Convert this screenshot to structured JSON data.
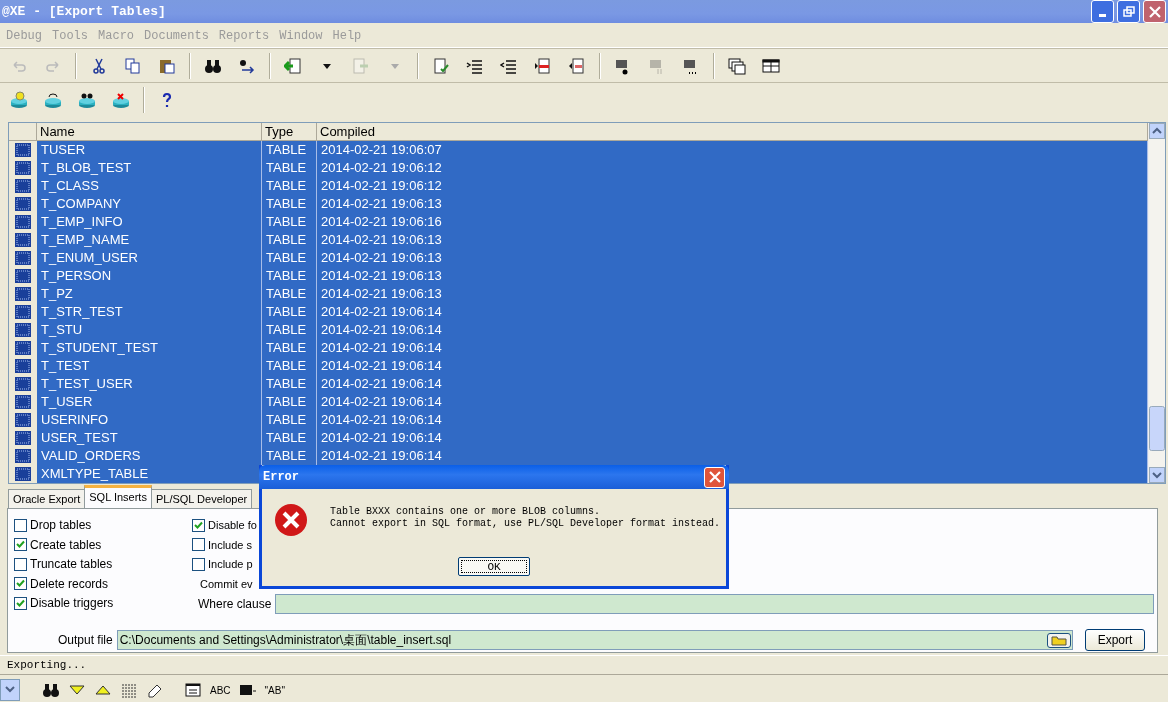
{
  "window": {
    "title": "@XE - [Export Tables]"
  },
  "menu": [
    {
      "label": "Debug",
      "disabled": true
    },
    {
      "label": "Tools",
      "disabled": true
    },
    {
      "label": "Macro",
      "disabled": true
    },
    {
      "label": "Documents",
      "disabled": true
    },
    {
      "label": "Reports",
      "disabled": true
    },
    {
      "label": "Window",
      "disabled": true
    },
    {
      "label": "Help",
      "disabled": true
    }
  ],
  "table": {
    "columns": [
      "Name",
      "Type",
      "Compiled"
    ],
    "rows": [
      {
        "cells": [
          "TUSER",
          "TABLE",
          "2014-02-21 19:06:07"
        ],
        "selected": true
      },
      {
        "cells": [
          "T_BLOB_TEST",
          "TABLE",
          "2014-02-21 19:06:12"
        ],
        "selected": true
      },
      {
        "cells": [
          "T_CLASS",
          "TABLE",
          "2014-02-21 19:06:12"
        ],
        "selected": true
      },
      {
        "cells": [
          "T_COMPANY",
          "TABLE",
          "2014-02-21 19:06:13"
        ],
        "selected": true
      },
      {
        "cells": [
          "T_EMP_INFO",
          "TABLE",
          "2014-02-21 19:06:16"
        ],
        "selected": true
      },
      {
        "cells": [
          "T_EMP_NAME",
          "TABLE",
          "2014-02-21 19:06:13"
        ],
        "selected": true
      },
      {
        "cells": [
          "T_ENUM_USER",
          "TABLE",
          "2014-02-21 19:06:13"
        ],
        "selected": true
      },
      {
        "cells": [
          "T_PERSON",
          "TABLE",
          "2014-02-21 19:06:13"
        ],
        "selected": true
      },
      {
        "cells": [
          "T_PZ",
          "TABLE",
          "2014-02-21 19:06:13"
        ],
        "selected": true
      },
      {
        "cells": [
          "T_STR_TEST",
          "TABLE",
          "2014-02-21 19:06:14"
        ],
        "selected": true
      },
      {
        "cells": [
          "T_STU",
          "TABLE",
          "2014-02-21 19:06:14"
        ],
        "selected": true
      },
      {
        "cells": [
          "T_STUDENT_TEST",
          "TABLE",
          "2014-02-21 19:06:14"
        ],
        "selected": true
      },
      {
        "cells": [
          "T_TEST",
          "TABLE",
          "2014-02-21 19:06:14"
        ],
        "selected": true
      },
      {
        "cells": [
          "T_TEST_USER",
          "TABLE",
          "2014-02-21 19:06:14"
        ],
        "selected": true
      },
      {
        "cells": [
          "T_USER",
          "TABLE",
          "2014-02-21 19:06:14"
        ],
        "selected": true
      },
      {
        "cells": [
          "USERINFO",
          "TABLE",
          "2014-02-21 19:06:14"
        ],
        "selected": true
      },
      {
        "cells": [
          "USER_TEST",
          "TABLE",
          "2014-02-21 19:06:14"
        ],
        "selected": true
      },
      {
        "cells": [
          "VALID_ORDERS",
          "TABLE",
          "2014-02-21 19:06:14"
        ],
        "selected": true
      },
      {
        "cells": [
          "XMLTYPE_TABLE"
        ],
        "selected": true
      }
    ]
  },
  "tabs": [
    {
      "label": "Oracle Export",
      "selected": false
    },
    {
      "label": "SQL Inserts",
      "selected": true
    },
    {
      "label": "PL/SQL Developer",
      "selected": false
    }
  ],
  "options": [
    {
      "label": "Drop tables",
      "checked": false
    },
    {
      "label": "Create tables",
      "checked": true
    },
    {
      "label": "Truncate tables",
      "checked": false
    },
    {
      "label": "Delete records",
      "checked": true
    },
    {
      "label": "Disable triggers",
      "checked": true
    }
  ],
  "options_2": [
    {
      "label": "Disable fo",
      "checked": true
    },
    {
      "label": "Include s",
      "checked": false
    },
    {
      "label": "Include p",
      "checked": false
    }
  ],
  "commit_label": "Commit ev",
  "where_clause": {
    "label": "Where clause"
  },
  "output_file": {
    "label": "Output file",
    "value": "C:\\Documents and Settings\\Administrator\\桌面\\table_insert.sql"
  },
  "export_button": "Export",
  "status": "Exporting...",
  "bottom_toolbar": {
    "labels": [
      "ABC",
      "\"AB\""
    ]
  },
  "dialog": {
    "title": "Error",
    "lines": [
      "Table BXXX contains one or more BLOB columns.",
      "Cannot export in SQL format, use PL/SQL Developer format instead."
    ],
    "button": "OK"
  }
}
